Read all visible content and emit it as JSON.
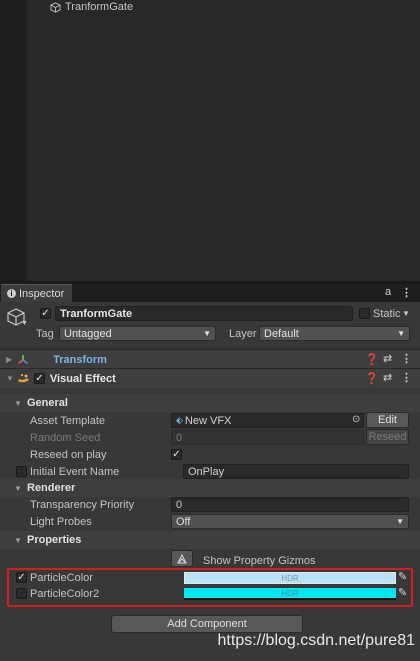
{
  "hierarchy": {
    "item_label": "TranformGate"
  },
  "inspector_tab": {
    "label": "Inspector",
    "lock": "a",
    "menu": "⋮"
  },
  "gameobject": {
    "name": "TranformGate",
    "active": "✓",
    "static_label": "Static",
    "tag_label": "Tag",
    "tag_value": "Untagged",
    "layer_label": "Layer",
    "layer_value": "Default"
  },
  "components": {
    "transform": {
      "label": "Transform"
    },
    "visual_effect": {
      "label": "Visual Effect",
      "enabled": "✓"
    }
  },
  "general": {
    "title": "General",
    "asset_template_label": "Asset Template",
    "asset_template_value": "New VFX",
    "edit_button": "Edit",
    "random_seed_label": "Random Seed",
    "random_seed_value": "0",
    "reseed_button": "Reseed",
    "reseed_on_play_label": "Reseed on play",
    "reseed_on_play_check": "✓",
    "initial_event_label": "Initial Event Name",
    "initial_event_value": "OnPlay"
  },
  "renderer": {
    "title": "Renderer",
    "transparency_label": "Transparency Priority",
    "transparency_value": "0",
    "light_probes_label": "Light Probes",
    "light_probes_value": "Off"
  },
  "properties": {
    "title": "Properties",
    "gizmos_label": "Show Property Gizmos",
    "particle_color_label": "ParticleColor",
    "particle_color_check": "✓",
    "particle_color_hdr": "HDR",
    "particle_color_hex": "#b7e3f8",
    "particle_color2_label": "ParticleColor2",
    "particle_color2_hdr": "HDR",
    "particle_color2_hex": "#00e7f2"
  },
  "add_component": {
    "label": "Add Component"
  },
  "watermark": {
    "text": "https://blog.csdn.net/pure81"
  }
}
